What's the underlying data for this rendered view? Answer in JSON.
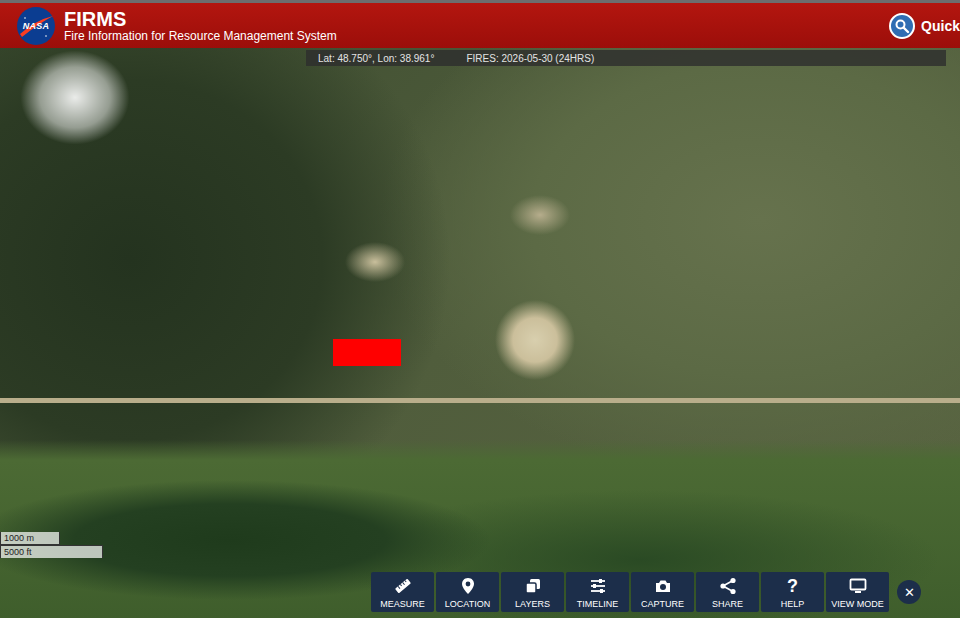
{
  "header": {
    "logo_text": "NASA",
    "title": "FIRMS",
    "subtitle": "Fire Information for Resource Management System",
    "quick_search": "Quick"
  },
  "info_bar": {
    "coords": "Lat: 48.750°, Lon: 38.961°",
    "fires": "FIRES: 2026-05-30 (24HRS)"
  },
  "scale": {
    "metric": "1000 m",
    "imperial": "5000 ft"
  },
  "toolbar": {
    "buttons": [
      {
        "label": "MEASURE"
      },
      {
        "label": "LOCATION"
      },
      {
        "label": "LAYERS"
      },
      {
        "label": "TIMELINE"
      },
      {
        "label": "CAPTURE"
      },
      {
        "label": "SHARE"
      },
      {
        "label": "HELP",
        "glyph": "?"
      },
      {
        "label": "VIEW MODE"
      }
    ],
    "close": "✕"
  }
}
